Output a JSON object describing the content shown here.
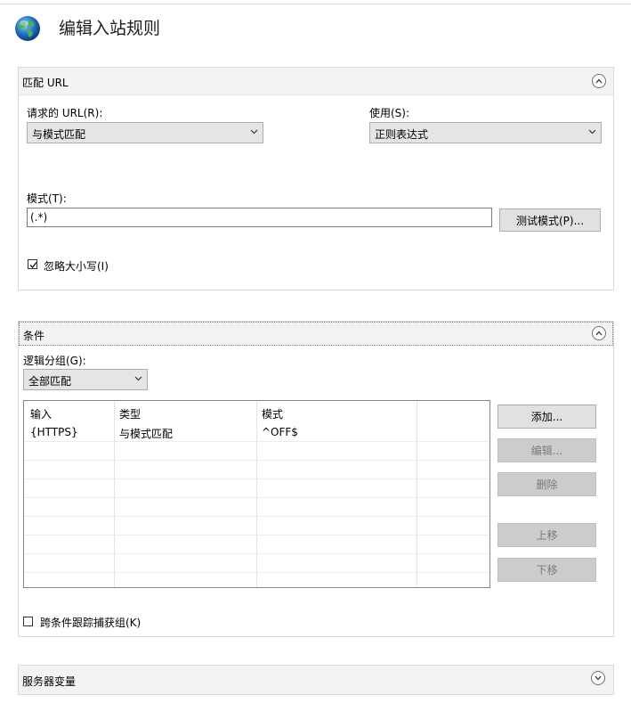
{
  "header": {
    "title": "编辑入站规则",
    "icon": "globe-icon"
  },
  "match_url": {
    "section_title": "匹配 URL",
    "requested_url_label": "请求的 URL(R):",
    "requested_url_value": "与模式匹配",
    "using_label": "使用(S):",
    "using_value": "正则表达式",
    "pattern_label": "模式(T):",
    "pattern_value": "(.*)",
    "test_pattern_button": "测试模式(P)...",
    "ignore_case_label": "忽略大小写(I)",
    "ignore_case_checked": true
  },
  "conditions": {
    "section_title": "条件",
    "logical_grouping_label": "逻辑分组(G):",
    "logical_grouping_value": "全部匹配",
    "columns": [
      "输入",
      "类型",
      "模式"
    ],
    "rows": [
      {
        "input": "{HTTPS}",
        "type": "与模式匹配",
        "pattern": "^OFF$"
      }
    ],
    "buttons": {
      "add": "添加...",
      "edit": "编辑...",
      "remove": "删除",
      "move_up": "上移",
      "move_down": "下移"
    },
    "track_groups_label": "跨条件跟踪捕获组(K)",
    "track_groups_checked": false
  },
  "server_variables": {
    "section_title": "服务器变量"
  },
  "colors": {
    "section_header_bg": "#f3f3f3",
    "disabled_button_bg": "#cccccc",
    "globe_blue": "#1f6fc5",
    "globe_green": "#4caf50"
  }
}
